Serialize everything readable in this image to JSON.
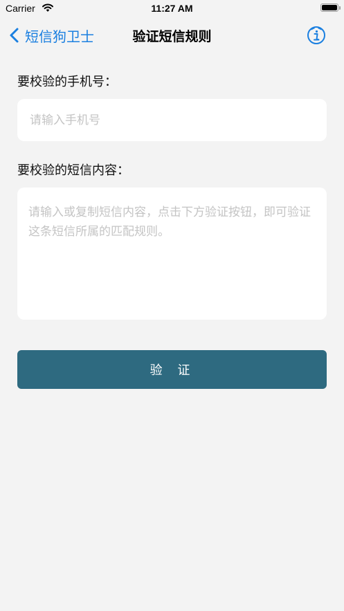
{
  "status_bar": {
    "carrier": "Carrier",
    "time": "11:27 AM",
    "wifi_icon": "wifi-icon",
    "battery_icon": "battery-icon"
  },
  "nav": {
    "back_label": "短信狗卫士",
    "back_icon": "chevron-left-icon",
    "title": "验证短信规则",
    "info_icon": "info-icon",
    "accent_color": "#1a7fe0"
  },
  "form": {
    "phone_label": "要校验的手机号：",
    "phone_value": "",
    "phone_placeholder": "请输入手机号",
    "sms_label": "要校验的短信内容：",
    "sms_value": "",
    "sms_placeholder": "请输入或复制短信内容，点击下方验证按钮，即可验证这条短信所属的匹配规则。",
    "verify_label": "验 证",
    "button_color": "#2e6a80"
  }
}
